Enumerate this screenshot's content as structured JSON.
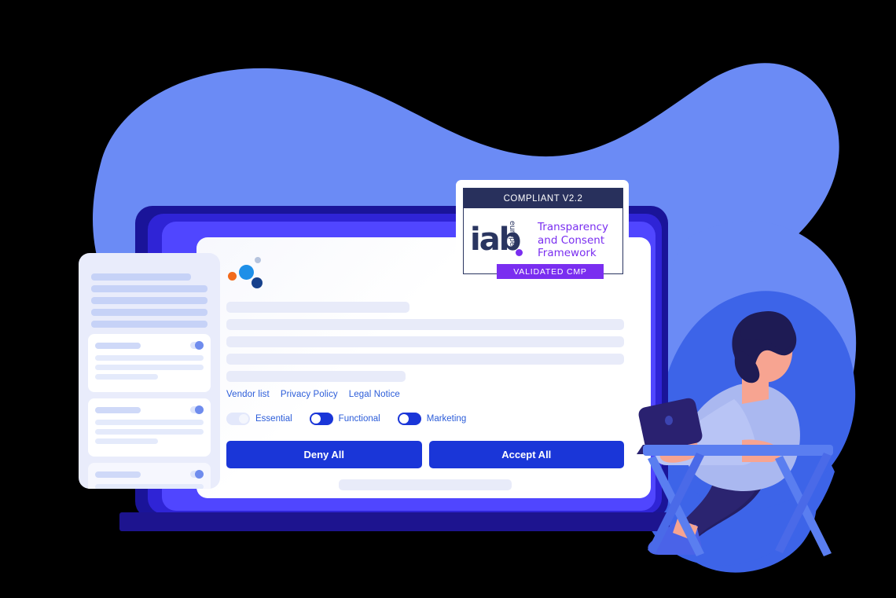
{
  "badge": {
    "top_banner": "COMPLIANT V2.2",
    "brand": "iab",
    "region": "europe",
    "tagline_line1": "Transparency",
    "tagline_line2": "and Consent",
    "tagline_line3": "Framework",
    "bottom_banner": "VALIDATED CMP",
    "colors": {
      "navy": "#28305c",
      "purple": "#7a2ef0"
    }
  },
  "consent_banner": {
    "logo": {
      "dots": [
        {
          "name": "orange-dot",
          "color": "#f26a1b"
        },
        {
          "name": "blue-dot",
          "color": "#1e8fe8"
        },
        {
          "name": "navy-dot",
          "color": "#17418c"
        },
        {
          "name": "grey-dot",
          "color": "#b6c4de"
        }
      ]
    },
    "placeholder_bars": [
      {
        "width": "46%"
      },
      {
        "width": "100%"
      },
      {
        "width": "100%"
      },
      {
        "width": "100%"
      },
      {
        "width": "45%"
      }
    ],
    "links": [
      {
        "label": "Vendor list"
      },
      {
        "label": "Privacy Policy"
      },
      {
        "label": "Legal Notice"
      }
    ],
    "toggles": [
      {
        "label": "Essential",
        "state": "off-locked"
      },
      {
        "label": "Functional",
        "state": "on"
      },
      {
        "label": "Marketing",
        "state": "on"
      }
    ],
    "buttons": {
      "deny": "Deny All",
      "accept": "Accept All"
    },
    "colors": {
      "accent": "#1a36d8",
      "link": "#2b5cd9",
      "placeholder": "#e8ebf9"
    }
  },
  "preferences_panel": {
    "header_bars": 5,
    "categories": [
      {
        "toggle": "on",
        "lines": 3
      },
      {
        "toggle": "on",
        "lines": 3
      },
      {
        "toggle": "on",
        "lines": 3
      }
    ],
    "colors": {
      "panel": "#e9ecfb",
      "bar": "#c6d2f7"
    }
  },
  "device": {
    "name": "laptop-mockup",
    "colors": {
      "outer": "#1a1499",
      "mid": "#2f24d6",
      "inner": "#5046ff",
      "base": "#1d148f"
    }
  },
  "illustration": {
    "name": "person-at-desk-with-laptop",
    "colors": {
      "blob_light": "#6b8bf5",
      "blob_dark": "#3d64e8",
      "skin": "#f7a491",
      "hair": "#1e1b54",
      "shirt": "#aab8f0",
      "pants": "#241e63",
      "desk": "#5a7ef0",
      "laptop": "#2a2170"
    }
  }
}
